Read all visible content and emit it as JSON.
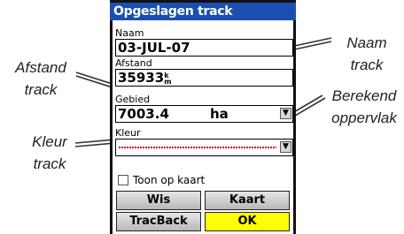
{
  "window": {
    "title": "Opgeslagen track"
  },
  "fields": {
    "name": {
      "label": "Naam",
      "value": "03-JUL-07"
    },
    "distance": {
      "label": "Afstand",
      "value": "35933",
      "unit_top": "k",
      "unit_bottom": "m"
    },
    "area": {
      "label": "Gebied",
      "value": "7003.4",
      "unit": "ha"
    },
    "color": {
      "label": "Kleur",
      "color": "#cc0000"
    }
  },
  "checkbox": {
    "label": "Toon op kaart",
    "checked": false
  },
  "buttons": {
    "delete": "Wis",
    "map": "Kaart",
    "tracback": "TracBack",
    "ok": "OK"
  },
  "callouts": {
    "name_track": [
      "Naam",
      "track"
    ],
    "distance_track": [
      "Afstand",
      "track"
    ],
    "area_computed": [
      "Berekend",
      "oppervlak"
    ],
    "color_track": [
      "Kleur",
      "track"
    ]
  }
}
